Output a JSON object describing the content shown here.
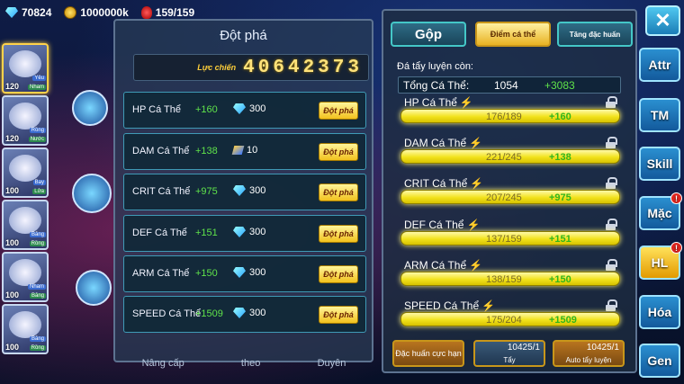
{
  "topbar": {
    "gems": "70824",
    "gold": "1000000k",
    "stamina": "159/159"
  },
  "team": [
    {
      "level": "120",
      "tags": [
        "Yêu",
        "Nham"
      ]
    },
    {
      "level": "120",
      "tags": [
        "Rồng",
        "Nước"
      ]
    },
    {
      "level": "100",
      "tags": [
        "Bay",
        "Lửa"
      ]
    },
    {
      "level": "100",
      "tags": [
        "Băng",
        "Rồng"
      ]
    },
    {
      "level": "100",
      "tags": [
        "Nham",
        "Băng"
      ]
    },
    {
      "level": "100",
      "tags": [
        "Băng",
        "Rồng"
      ]
    }
  ],
  "breakthrough": {
    "title": "Đột phá",
    "power_label": "Lực chiến",
    "power_value": "40642373",
    "button_label": "Đột phá",
    "rows": [
      {
        "name": "HP Cá Thể",
        "bonus": "+160",
        "cost": "300",
        "currency": "gem"
      },
      {
        "name": "DAM Cá Thể",
        "bonus": "+138",
        "cost": "10",
        "currency": "scroll"
      },
      {
        "name": "CRIT Cá Thể",
        "bonus": "+975",
        "cost": "300",
        "currency": "gem"
      },
      {
        "name": "DEF Cá Thể",
        "bonus": "+151",
        "cost": "300",
        "currency": "gem"
      },
      {
        "name": "ARM Cá Thể",
        "bonus": "+150",
        "cost": "300",
        "currency": "gem"
      },
      {
        "name": "SPEED Cá Thể",
        "bonus": "+1509",
        "cost": "300",
        "currency": "gem"
      }
    ]
  },
  "bottom_nav": [
    "Nâng cấp",
    "theo",
    "Duyên"
  ],
  "tabs": {
    "merge": "Gộp",
    "individual": "Điểm cá thể",
    "special": "Tăng đặc huấn"
  },
  "training": {
    "remaining_label": "Đá tẩy luyện còn:",
    "total_label": "Tổng Cá Thể:",
    "total_value": "1054",
    "total_bonus": "+3083",
    "stats": [
      {
        "name": "HP Cá Thể",
        "value": "176/189",
        "bonus": "+160"
      },
      {
        "name": "DAM Cá Thể",
        "value": "221/245",
        "bonus": "+138"
      },
      {
        "name": "CRIT Cá Thể",
        "value": "207/245",
        "bonus": "+975"
      },
      {
        "name": "DEF Cá Thể",
        "value": "137/159",
        "bonus": "+151"
      },
      {
        "name": "ARM Cá Thể",
        "value": "138/159",
        "bonus": "+150"
      },
      {
        "name": "SPEED Cá Thể",
        "value": "175/204",
        "bonus": "+1509"
      }
    ],
    "actions": {
      "special_training": "Đặc huấn cực hạn",
      "wash_count": "10425/1",
      "wash_label": "Tẩy",
      "auto_count": "10425/1",
      "auto_label": "Auto tẩy luyện"
    }
  },
  "side_buttons": [
    "Attr",
    "TM",
    "Skill",
    "Mặc",
    "HL",
    "Hóa",
    "Gen"
  ],
  "badge_text": "!"
}
